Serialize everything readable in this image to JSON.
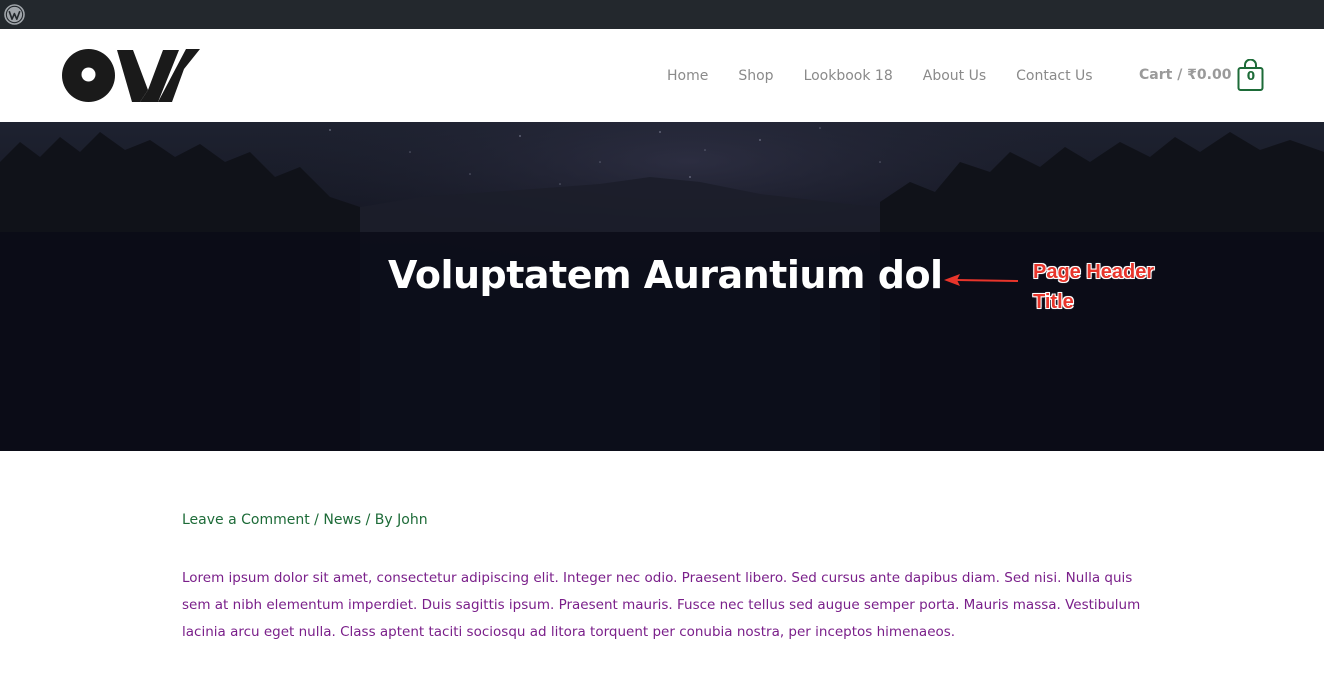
{
  "admin_bar": {
    "icon": "wordpress-icon"
  },
  "header": {
    "logo": {
      "icon": "site-logo"
    },
    "nav": [
      {
        "label": "Home"
      },
      {
        "label": "Shop"
      },
      {
        "label": "Lookbook 18"
      },
      {
        "label": "About Us"
      },
      {
        "label": "Contact Us"
      }
    ],
    "cart": {
      "label": "Cart / ₹0.00",
      "count": "0",
      "icon": "shopping-bag-icon"
    }
  },
  "hero": {
    "title": "Voluptatem Aurantium dol",
    "annotation": {
      "line1": "Page Header",
      "line2": "Title",
      "color": "#e8352b"
    }
  },
  "post": {
    "meta": {
      "comment_link": "Leave a Comment",
      "sep1": " / ",
      "category": "News",
      "sep2": " / By ",
      "author": "John"
    },
    "content": "Lorem ipsum dolor sit amet, consectetur adipiscing elit. Integer nec odio. Praesent libero. Sed cursus ante dapibus diam. Sed nisi. Nulla quis sem at nibh elementum imperdiet. Duis sagittis ipsum. Praesent mauris. Fusce nec tellus sed augue semper porta. Mauris massa. Vestibulum lacinia arcu eget nulla. Class aptent taciti sociosqu ad litora torquent per conubia nostra, per inceptos himenaeos."
  },
  "colors": {
    "accent_green": "#1d6b38",
    "content_purple": "#7a1f8a",
    "admin_bar": "#23282d"
  }
}
